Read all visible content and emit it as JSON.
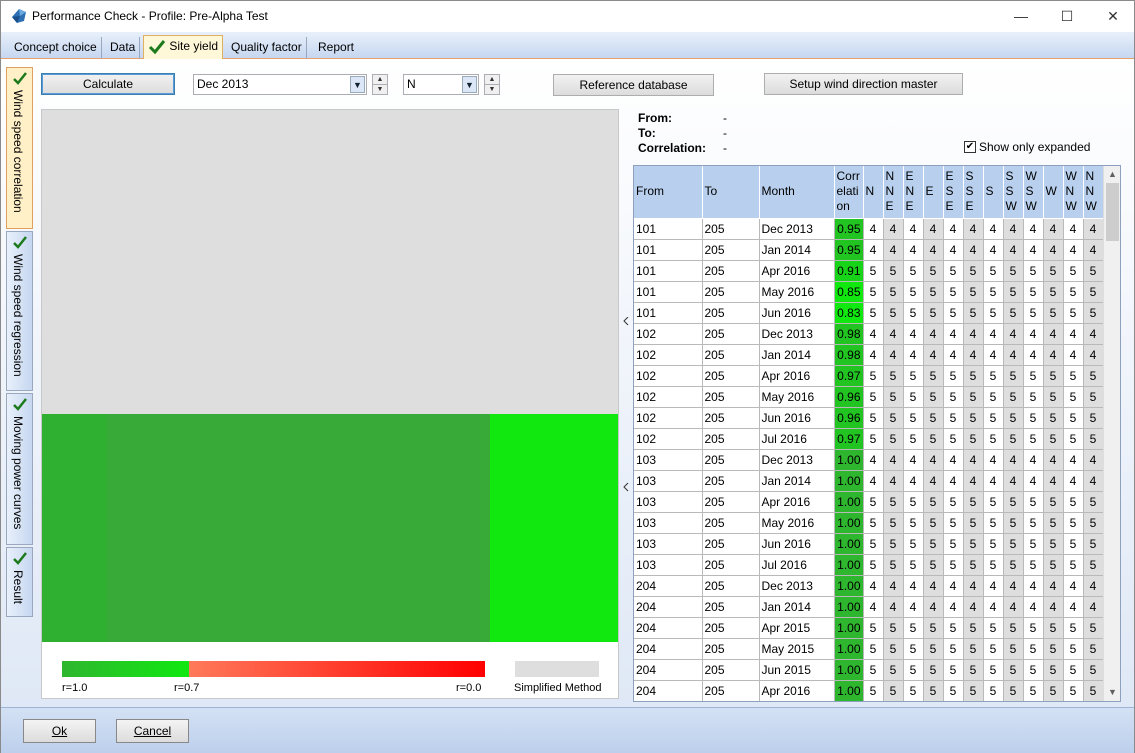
{
  "window": {
    "title": "Performance Check - Profile: Pre-Alpha Test"
  },
  "top_tabs": [
    {
      "label": "Concept choice",
      "active": false,
      "checked": false
    },
    {
      "label": "Data",
      "active": false,
      "checked": false
    },
    {
      "label": "Site yield",
      "active": true,
      "checked": true
    },
    {
      "label": "Quality factor",
      "active": false,
      "checked": false
    },
    {
      "label": "Report",
      "active": false,
      "checked": false
    }
  ],
  "side_tabs": [
    {
      "label": "Wind speed correlation",
      "active": true
    },
    {
      "label": "Wind speed regression",
      "active": false
    },
    {
      "label": "Moving power curves",
      "active": false
    },
    {
      "label": "Result",
      "active": false
    }
  ],
  "toolbar": {
    "calculate": "Calculate",
    "month_value": "Dec 2013",
    "direction_value": "N",
    "reference_db": "Reference database",
    "setup_wind": "Setup wind direction master"
  },
  "info": {
    "from_label": "From:",
    "from_value": "-",
    "to_label": "To:",
    "to_value": "-",
    "corr_label": "Correlation:",
    "corr_value": "-",
    "show_expanded": "Show only expanded",
    "show_expanded_checked": true
  },
  "legend": {
    "r1": "r=1.0",
    "r07": "r=0.7",
    "r0": "r=0.0",
    "simplified": "Simplified Method"
  },
  "colors": {
    "good": "#2fb62f",
    "better": "#10e810",
    "bad": "#ff0000",
    "simplified": "#dedede",
    "header": "#b8d0ee"
  },
  "grid": {
    "headers": [
      "From",
      "To",
      "Month",
      "Correlation",
      "N",
      "NNE",
      "ENE",
      "E",
      "ESE",
      "SSE",
      "S",
      "SSW",
      "WSW",
      "W",
      "WNW",
      "NNW"
    ],
    "rows": [
      {
        "from": "101",
        "to": "205",
        "month": "Dec 2013",
        "corr": "0.95",
        "d": "4"
      },
      {
        "from": "101",
        "to": "205",
        "month": "Jan 2014",
        "corr": "0.95",
        "d": "4"
      },
      {
        "from": "101",
        "to": "205",
        "month": "Apr 2016",
        "corr": "0.91",
        "d": "5"
      },
      {
        "from": "101",
        "to": "205",
        "month": "May 2016",
        "corr": "0.85",
        "d": "5"
      },
      {
        "from": "101",
        "to": "205",
        "month": "Jun 2016",
        "corr": "0.83",
        "d": "5"
      },
      {
        "from": "102",
        "to": "205",
        "month": "Dec 2013",
        "corr": "0.98",
        "d": "4"
      },
      {
        "from": "102",
        "to": "205",
        "month": "Jan 2014",
        "corr": "0.98",
        "d": "4"
      },
      {
        "from": "102",
        "to": "205",
        "month": "Apr 2016",
        "corr": "0.97",
        "d": "5"
      },
      {
        "from": "102",
        "to": "205",
        "month": "May 2016",
        "corr": "0.96",
        "d": "5"
      },
      {
        "from": "102",
        "to": "205",
        "month": "Jun 2016",
        "corr": "0.96",
        "d": "5"
      },
      {
        "from": "102",
        "to": "205",
        "month": "Jul 2016",
        "corr": "0.97",
        "d": "5"
      },
      {
        "from": "103",
        "to": "205",
        "month": "Dec 2013",
        "corr": "1.00",
        "d": "4"
      },
      {
        "from": "103",
        "to": "205",
        "month": "Jan 2014",
        "corr": "1.00",
        "d": "4"
      },
      {
        "from": "103",
        "to": "205",
        "month": "Apr 2016",
        "corr": "1.00",
        "d": "5"
      },
      {
        "from": "103",
        "to": "205",
        "month": "May 2016",
        "corr": "1.00",
        "d": "5"
      },
      {
        "from": "103",
        "to": "205",
        "month": "Jun 2016",
        "corr": "1.00",
        "d": "5"
      },
      {
        "from": "103",
        "to": "205",
        "month": "Jul 2016",
        "corr": "1.00",
        "d": "5"
      },
      {
        "from": "204",
        "to": "205",
        "month": "Dec 2013",
        "corr": "1.00",
        "d": "4"
      },
      {
        "from": "204",
        "to": "205",
        "month": "Jan 2014",
        "corr": "1.00",
        "d": "4"
      },
      {
        "from": "204",
        "to": "205",
        "month": "Apr 2015",
        "corr": "1.00",
        "d": "5"
      },
      {
        "from": "204",
        "to": "205",
        "month": "May 2015",
        "corr": "1.00",
        "d": "5"
      },
      {
        "from": "204",
        "to": "205",
        "month": "Jun 2015",
        "corr": "1.00",
        "d": "5"
      },
      {
        "from": "204",
        "to": "205",
        "month": "Apr 2016",
        "corr": "1.00",
        "d": "5"
      }
    ]
  },
  "footer": {
    "ok": "Ok",
    "cancel": "Cancel"
  }
}
